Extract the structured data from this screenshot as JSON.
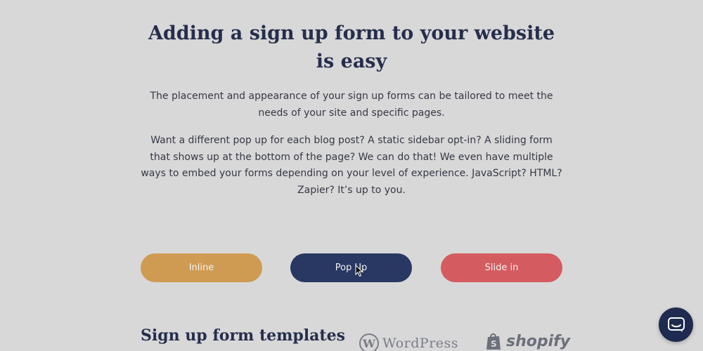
{
  "hero": {
    "title": "Adding a sign up form to your website is easy",
    "paragraph1": "The placement and appearance of your sign up forms can be tailored to meet the needs of your site and specific pages.",
    "paragraph2": "Want a different pop up for each blog post? A static sidebar opt-in? A sliding form that shows up at the bottom of the page? We can do that! We even have multiple ways to embed your forms depending on your level of experience. JavaScript? HTML? Zapier? It’s up to you."
  },
  "form_types": {
    "inline_label": "Inline",
    "popup_label": "Pop Up",
    "slidein_label": "Slide in"
  },
  "templates": {
    "title": "Sign up form templates"
  },
  "logos": {
    "wordpress_text": "WordPress",
    "shopify_text": "shopify"
  },
  "icons": {
    "cursor": "pointer-cursor-icon",
    "chat": "chat-bubble-icon"
  },
  "colors": {
    "inline": "#cf9b52",
    "popup": "#283863",
    "slidein": "#d45b5f",
    "heading": "#262e4c"
  }
}
